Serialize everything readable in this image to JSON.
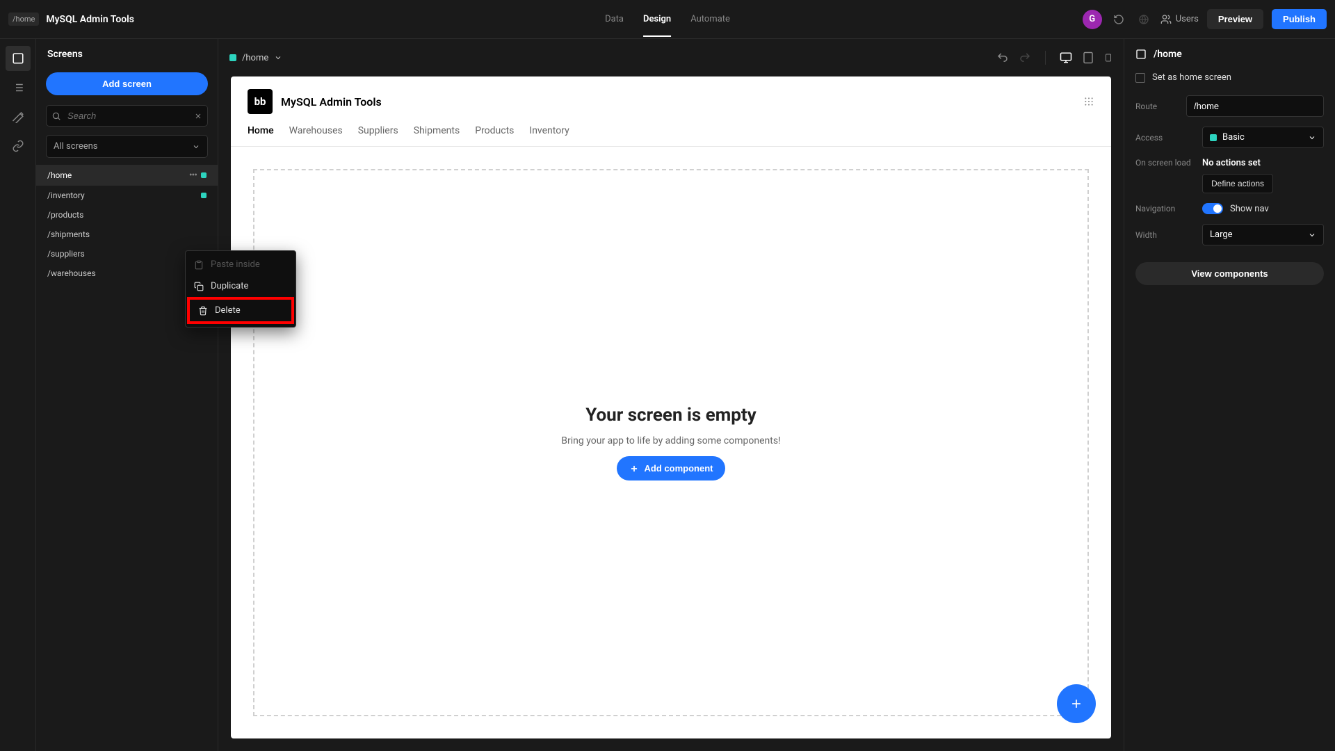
{
  "header": {
    "home_badge": "/home",
    "app_title": "MySQL Admin Tools",
    "nav": {
      "data": "Data",
      "design": "Design",
      "automate": "Automate"
    },
    "avatar_letter": "G",
    "users_label": "Users",
    "preview_label": "Preview",
    "publish_label": "Publish"
  },
  "left_panel": {
    "title": "Screens",
    "add_screen": "Add screen",
    "search_placeholder": "Search",
    "screens_filter": "All screens",
    "screens": [
      "/home",
      "/inventory",
      "/products",
      "/shipments",
      "/suppliers",
      "/warehouses"
    ]
  },
  "context_menu": {
    "paste": "Paste inside",
    "duplicate": "Duplicate",
    "delete": "Delete"
  },
  "canvas": {
    "crumb": "/home",
    "app_title": "MySQL Admin Tools",
    "logo_text": "bb",
    "tabs": [
      "Home",
      "Warehouses",
      "Suppliers",
      "Shipments",
      "Products",
      "Inventory"
    ],
    "empty_title": "Your screen is empty",
    "empty_sub": "Bring your app to life by adding some components!",
    "add_component": "Add component"
  },
  "right_panel": {
    "title": "/home",
    "set_home": "Set as home screen",
    "route_label": "Route",
    "route_value": "/home",
    "access_label": "Access",
    "access_value": "Basic",
    "onload_label": "On screen load",
    "no_actions": "No actions set",
    "define_actions": "Define actions",
    "nav_label": "Navigation",
    "show_nav": "Show nav",
    "width_label": "Width",
    "width_value": "Large",
    "view_components": "View components"
  }
}
